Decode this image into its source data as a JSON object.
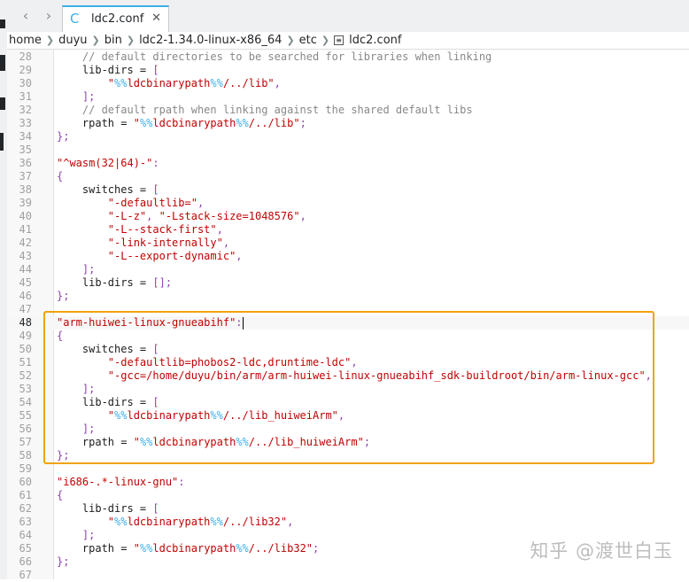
{
  "tab": {
    "icon": "config-file-icon",
    "label": "ldc2.conf",
    "close": "✕"
  },
  "nav": {
    "back": "‹",
    "forward": "›"
  },
  "breadcrumb": [
    "home",
    "duyu",
    "bin",
    "ldc2-1.34.0-linux-x86_64",
    "etc",
    "ldc2.conf"
  ],
  "editor": {
    "current_line": 48,
    "lines": [
      {
        "n": "28",
        "t": [
          [
            "cmt",
            "    // default directories to be searched for libraries when linking"
          ]
        ]
      },
      {
        "n": "29",
        "t": [
          [
            "plain",
            "    lib-dirs = "
          ],
          [
            "sym",
            "["
          ]
        ]
      },
      {
        "n": "30",
        "t": [
          [
            "plain",
            "        "
          ],
          [
            "str",
            "\""
          ],
          [
            "esc",
            "%%"
          ],
          [
            "str",
            "ldcbinarypath"
          ],
          [
            "esc",
            "%%"
          ],
          [
            "str",
            "/../lib\""
          ],
          [
            "sym",
            ","
          ]
        ]
      },
      {
        "n": "31",
        "t": [
          [
            "sym",
            "    ];"
          ]
        ]
      },
      {
        "n": "32",
        "t": [
          [
            "cmt",
            "    // default rpath when linking against the shared default libs"
          ]
        ]
      },
      {
        "n": "33",
        "t": [
          [
            "plain",
            "    rpath = "
          ],
          [
            "str",
            "\""
          ],
          [
            "esc",
            "%%"
          ],
          [
            "str",
            "ldcbinarypath"
          ],
          [
            "esc",
            "%%"
          ],
          [
            "str",
            "/../lib\""
          ],
          [
            "sym",
            ";"
          ]
        ]
      },
      {
        "n": "34",
        "t": [
          [
            "sym",
            "};"
          ]
        ]
      },
      {
        "n": "35",
        "t": []
      },
      {
        "n": "36",
        "t": [
          [
            "str",
            "\"^wasm(32|64)-\""
          ],
          [
            "sym",
            ":"
          ]
        ]
      },
      {
        "n": "37",
        "t": [
          [
            "sym",
            "{"
          ]
        ]
      },
      {
        "n": "38",
        "t": [
          [
            "plain",
            "    switches = "
          ],
          [
            "sym",
            "["
          ]
        ]
      },
      {
        "n": "39",
        "t": [
          [
            "plain",
            "        "
          ],
          [
            "str",
            "\"-defaultlib=\""
          ],
          [
            "sym",
            ","
          ]
        ]
      },
      {
        "n": "40",
        "t": [
          [
            "plain",
            "        "
          ],
          [
            "str",
            "\"-L-z\""
          ],
          [
            "sym",
            ", "
          ],
          [
            "str",
            "\"-Lstack-size=1048576\""
          ],
          [
            "sym",
            ","
          ]
        ]
      },
      {
        "n": "41",
        "t": [
          [
            "plain",
            "        "
          ],
          [
            "str",
            "\"-L--stack-first\""
          ],
          [
            "sym",
            ","
          ]
        ]
      },
      {
        "n": "42",
        "t": [
          [
            "plain",
            "        "
          ],
          [
            "str",
            "\"-link-internally\""
          ],
          [
            "sym",
            ","
          ]
        ]
      },
      {
        "n": "43",
        "t": [
          [
            "plain",
            "        "
          ],
          [
            "str",
            "\"-L--export-dynamic\""
          ],
          [
            "sym",
            ","
          ]
        ]
      },
      {
        "n": "44",
        "t": [
          [
            "sym",
            "    ];"
          ]
        ]
      },
      {
        "n": "45",
        "t": [
          [
            "plain",
            "    lib-dirs = "
          ],
          [
            "sym",
            "[];"
          ]
        ]
      },
      {
        "n": "46",
        "t": [
          [
            "sym",
            "};"
          ]
        ]
      },
      {
        "n": "47",
        "t": []
      },
      {
        "n": "48",
        "t": [
          [
            "str",
            "\"arm-huiwei-linux-gnueabihf\""
          ],
          [
            "sym",
            ":"
          ]
        ],
        "cursor": true
      },
      {
        "n": "49",
        "t": [
          [
            "sym",
            "{"
          ]
        ]
      },
      {
        "n": "50",
        "t": [
          [
            "plain",
            "    switches = "
          ],
          [
            "sym",
            "["
          ]
        ]
      },
      {
        "n": "51",
        "t": [
          [
            "plain",
            "        "
          ],
          [
            "str",
            "\"-defaultlib=phobos2-ldc,druntime-ldc\""
          ],
          [
            "sym",
            ","
          ]
        ]
      },
      {
        "n": "52",
        "t": [
          [
            "plain",
            "        "
          ],
          [
            "str",
            "\"-gcc=/home/duyu/bin/arm/arm-huiwei-linux-gnueabihf_sdk-buildroot/bin/arm-linux-gcc\""
          ],
          [
            "sym",
            ","
          ]
        ]
      },
      {
        "n": "53",
        "t": [
          [
            "sym",
            "    ];"
          ]
        ]
      },
      {
        "n": "54",
        "t": [
          [
            "plain",
            "    lib-dirs = "
          ],
          [
            "sym",
            "["
          ]
        ]
      },
      {
        "n": "55",
        "t": [
          [
            "plain",
            "        "
          ],
          [
            "str",
            "\""
          ],
          [
            "esc",
            "%%"
          ],
          [
            "str",
            "ldcbinarypath"
          ],
          [
            "esc",
            "%%"
          ],
          [
            "str",
            "/../lib_huiweiArm\""
          ],
          [
            "sym",
            ","
          ]
        ]
      },
      {
        "n": "56",
        "t": [
          [
            "sym",
            "    ];"
          ]
        ]
      },
      {
        "n": "57",
        "t": [
          [
            "plain",
            "    rpath = "
          ],
          [
            "str",
            "\""
          ],
          [
            "esc",
            "%%"
          ],
          [
            "str",
            "ldcbinarypath"
          ],
          [
            "esc",
            "%%"
          ],
          [
            "str",
            "/../lib_huiweiArm\""
          ],
          [
            "sym",
            ";"
          ]
        ]
      },
      {
        "n": "58",
        "t": [
          [
            "sym",
            "};"
          ]
        ]
      },
      {
        "n": "59",
        "t": []
      },
      {
        "n": "60",
        "t": [
          [
            "str",
            "\"i686-.*-linux-gnu\""
          ],
          [
            "sym",
            ":"
          ]
        ]
      },
      {
        "n": "61",
        "t": [
          [
            "sym",
            "{"
          ]
        ]
      },
      {
        "n": "62",
        "t": [
          [
            "plain",
            "    lib-dirs = "
          ],
          [
            "sym",
            "["
          ]
        ]
      },
      {
        "n": "63",
        "t": [
          [
            "plain",
            "        "
          ],
          [
            "str",
            "\""
          ],
          [
            "esc",
            "%%"
          ],
          [
            "str",
            "ldcbinarypath"
          ],
          [
            "esc",
            "%%"
          ],
          [
            "str",
            "/../lib32\""
          ],
          [
            "sym",
            ","
          ]
        ]
      },
      {
        "n": "64",
        "t": [
          [
            "sym",
            "    ];"
          ]
        ]
      },
      {
        "n": "65",
        "t": [
          [
            "plain",
            "    rpath = "
          ],
          [
            "str",
            "\""
          ],
          [
            "esc",
            "%%"
          ],
          [
            "str",
            "ldcbinarypath"
          ],
          [
            "esc",
            "%%"
          ],
          [
            "str",
            "/../lib32\""
          ],
          [
            "sym",
            ";"
          ]
        ]
      },
      {
        "n": "66",
        "t": [
          [
            "sym",
            "};"
          ]
        ]
      },
      {
        "n": "67",
        "t": []
      }
    ]
  },
  "watermark": "知乎 @渡世白玉"
}
